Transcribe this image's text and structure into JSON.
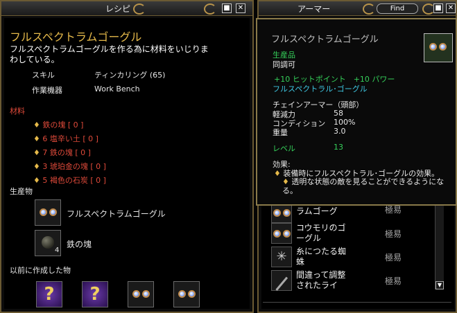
{
  "recipe_window": {
    "title": "レシピ",
    "item_name": "フルスペクトラムゴーグル",
    "description": "フルスペクトラムゴーグルを作る為に材料をいじりまわしている。",
    "skill_label": "スキル",
    "skill_value": "ティンカリング (65)",
    "equipment_label": "作業機器",
    "equipment_value": "Work Bench",
    "materials_header": "材料",
    "materials": [
      "鉄の塊 [ 0 ]",
      "6 塩辛い土 [ 0 ]",
      "7 鉄の塊 [ 0 ]",
      "3 琥珀金の塊 [ 0 ]",
      "5 褐色の石炭 [ 0 ]"
    ],
    "products_header": "生産物",
    "products": [
      {
        "name": "フルスペクトラムゴーグル",
        "icon": "goggles-icon",
        "count": ""
      },
      {
        "name": "鉄の塊",
        "icon": "iron-lump-icon",
        "count": "4"
      }
    ],
    "previous_header": "以前に作成した物",
    "previous_items": [
      {
        "icon": "question-mark-icon"
      },
      {
        "icon": "question-mark-icon"
      },
      {
        "icon": "goggles-icon"
      },
      {
        "icon": "goggles-icon"
      }
    ],
    "min_button": "■",
    "close_button": "✕"
  },
  "armor_window": {
    "title": "アーマー",
    "find_button": "Find",
    "min_button": "■",
    "close_button": "✕",
    "list": [
      {
        "name": "ラムゴーグ",
        "difficulty": "極易",
        "icon": "goggles-icon"
      },
      {
        "name": "コウモリのゴーグル",
        "difficulty": "極易",
        "icon": "goggles-icon"
      },
      {
        "name": "糸につたる蜘蛛",
        "difficulty": "極易",
        "icon": "spider-icon"
      },
      {
        "name": "間違って調整されたライ",
        "difficulty": "極易",
        "icon": "rod-icon"
      }
    ]
  },
  "tooltip": {
    "item_name": "フルスペクトラムゴーグル",
    "crafted_label": "生産品",
    "stackable_label": "同調可",
    "bonus_line": "+10 ヒットポイント　+10 パワー",
    "set_name": "フルスペクトラル･ゴーグル",
    "armor_type": "チェインアーマー（頭部）",
    "stats": [
      {
        "label": "軽減力",
        "value": "58"
      },
      {
        "label": "コンディション",
        "value": "100%"
      },
      {
        "label": "重量",
        "value": "3.0"
      }
    ],
    "level_label": "レベル",
    "level_value": "13",
    "effect_header": "効果:",
    "effect_line1": "装備時にフルスペクトラル･ゴーグルの効果。",
    "effect_line2": "透明な状態の敵を見ることができるようになる。"
  }
}
